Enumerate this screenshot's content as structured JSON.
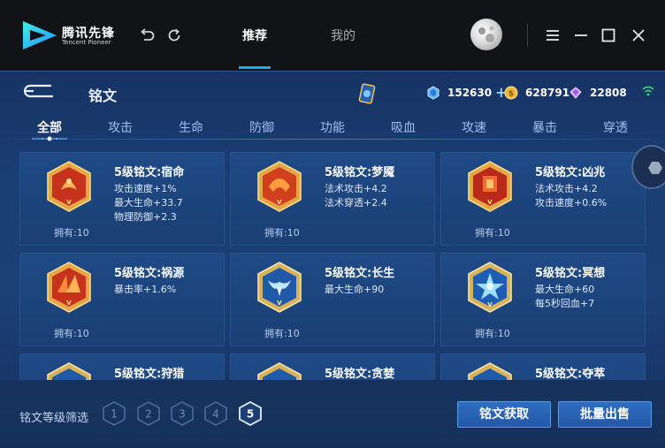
{
  "app": {
    "brand_name": "腾讯先锋",
    "brand_sub": "Tencent Pioneer"
  },
  "nav": {
    "tabs": [
      {
        "label": "推荐",
        "active": true
      },
      {
        "label": "我的",
        "active": false
      }
    ]
  },
  "header": {
    "title": "铭文",
    "currencies": [
      {
        "icon": "crystal-icon",
        "value": "152630",
        "has_add": true
      },
      {
        "icon": "gold-coin-icon",
        "value": "628791",
        "has_add": false
      },
      {
        "icon": "diamond-icon",
        "value": "22808",
        "has_add": false
      }
    ]
  },
  "categories": [
    "全部",
    "攻击",
    "生命",
    "防御",
    "功能",
    "吸血",
    "攻速",
    "暴击",
    "穿透"
  ],
  "active_category": "全部",
  "inscriptions": [
    {
      "name": "5级铭文:宿命",
      "stats": [
        "攻击速度+1%",
        "最大生命+33.7",
        "物理防御+2.3"
      ],
      "owned": "拥有:10",
      "color": "red"
    },
    {
      "name": "5级铭文:梦魇",
      "stats": [
        "法术攻击+4.2",
        "法术穿透+2.4"
      ],
      "owned": "拥有:10",
      "color": "red"
    },
    {
      "name": "5级铭文:凶兆",
      "stats": [
        "法术攻击+4.2",
        "攻击速度+0.6%"
      ],
      "owned": "拥有:10",
      "color": "red"
    },
    {
      "name": "5级铭文:祸源",
      "stats": [
        "暴击率+1.6%"
      ],
      "owned": "拥有:10",
      "color": "red"
    },
    {
      "name": "5级铭文:长生",
      "stats": [
        "最大生命+90"
      ],
      "owned": "拥有:10",
      "color": "blue"
    },
    {
      "name": "5级铭文:冥想",
      "stats": [
        "最大生命+60",
        "每5秒回血+7"
      ],
      "owned": "拥有:10",
      "color": "blue"
    },
    {
      "name": "5级铭文:狩猎",
      "stats": [],
      "owned": "",
      "color": "blue"
    },
    {
      "name": "5级铭文:贪婪",
      "stats": [],
      "owned": "",
      "color": "blue"
    },
    {
      "name": "5级铭文:夺萃",
      "stats": [],
      "owned": "",
      "color": "blue"
    }
  ],
  "filter": {
    "label": "铭文等级筛选",
    "levels": [
      "1",
      "2",
      "3",
      "4",
      "5"
    ],
    "selected": "5"
  },
  "actions": {
    "obtain": "铭文获取",
    "bulk_sell": "批量出售"
  },
  "colors": {
    "accent": "#1fa7ff",
    "panel": "#1b3e74",
    "button": "#2b63b4"
  }
}
